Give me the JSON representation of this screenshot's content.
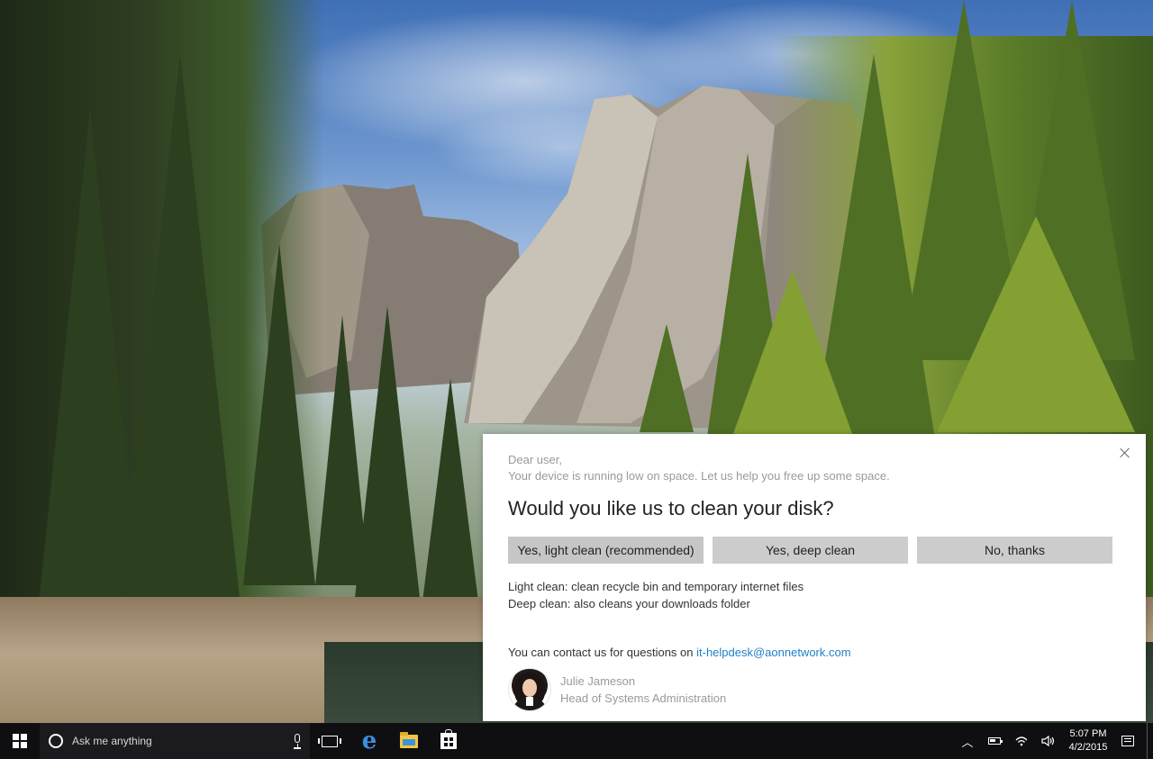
{
  "dialog": {
    "greeting": "Dear user,",
    "intro": "Your device is running low on space. Let us help you free up some space.",
    "question": "Would you like us to clean your disk?",
    "buttons": {
      "light": "Yes, light clean (recommended)",
      "deep": "Yes, deep clean",
      "no": "No, thanks"
    },
    "descriptions": {
      "light": "Light clean: clean recycle bin and temporary internet files",
      "deep": "Deep clean: also cleans your downloads folder"
    },
    "contact": {
      "prefix": "You can contact us for questions on ",
      "email": "it-helpdesk@aonnetwork.com"
    },
    "signature": {
      "name": "Julie Jameson",
      "title": "Head of Systems Administration"
    },
    "link_color": "#1f80c7"
  },
  "taskbar": {
    "search_placeholder": "Ask me anything",
    "clock": {
      "time": "5:07 PM",
      "date": "4/2/2015"
    },
    "pinned_icons": [
      "task-view-icon",
      "edge-icon",
      "file-explorer-icon",
      "store-icon"
    ],
    "tray_icons": [
      "chevron-up-icon",
      "battery-icon",
      "wifi-icon",
      "volume-icon",
      "action-center-icon"
    ],
    "background_color": "#0f0f12"
  }
}
